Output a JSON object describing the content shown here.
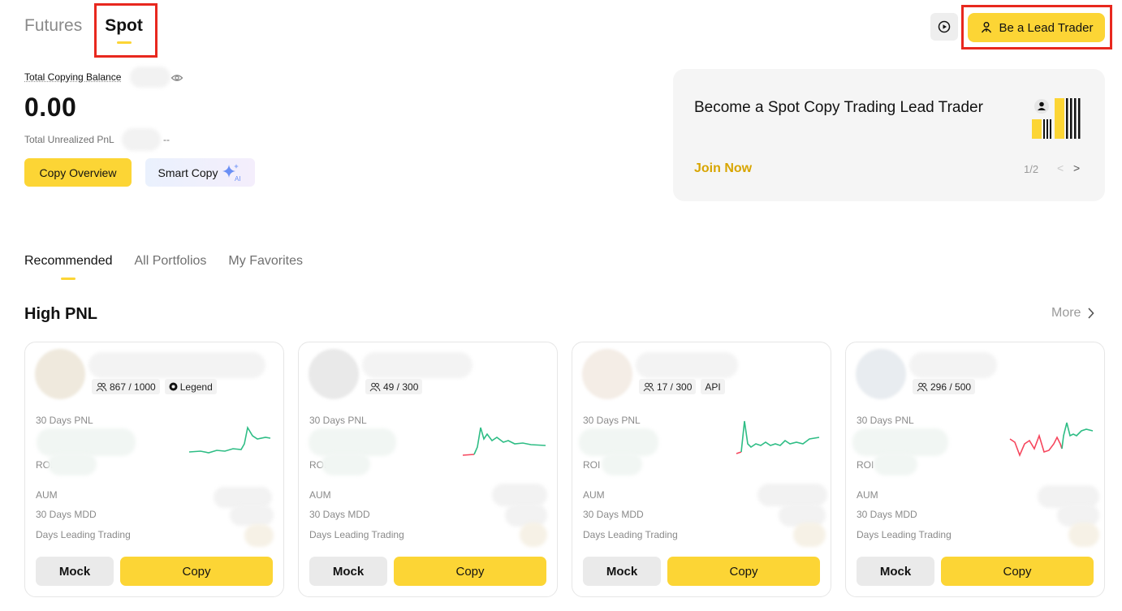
{
  "top_tabs": [
    {
      "label": "Futures",
      "active": false
    },
    {
      "label": "Spot",
      "active": true
    }
  ],
  "header": {
    "lead_trader_label": "Be a Lead Trader",
    "play_icon": "play-circle-icon",
    "lead_icon": "person-icon"
  },
  "balance": {
    "label": "Total Copying Balance",
    "value": "0.00",
    "pnl_label": "Total Unrealized PnL",
    "pnl_value": "--",
    "copy_overview_label": "Copy Overview",
    "smart_copy_label": "Smart Copy",
    "smart_copy_icon": "sparkle-ai-icon"
  },
  "promo": {
    "title": "Become a Spot Copy Trading Lead Trader",
    "cta": "Join Now",
    "page": "1/2",
    "prev": "<",
    "next": ">"
  },
  "sub_tabs": [
    {
      "label": "Recommended",
      "active": true
    },
    {
      "label": "All Portfolios",
      "active": false
    },
    {
      "label": "My Favorites",
      "active": false
    }
  ],
  "section": {
    "title": "High PNL",
    "more_label": "More"
  },
  "cards": [
    {
      "copiers": "867 / 1000",
      "tag": "Legend",
      "pnl_label": "30 Days PNL",
      "roi_label": "ROI",
      "aum_label": "AUM",
      "mdd_label": "30 Days MDD",
      "days_label": "Days Leading Trading",
      "mock_label": "Mock",
      "copy_label": "Copy"
    },
    {
      "copiers": "49 / 300",
      "tag": "",
      "pnl_label": "30 Days PNL",
      "roi_label": "ROI",
      "aum_label": "AUM",
      "mdd_label": "30 Days MDD",
      "days_label": "Days Leading Trading",
      "mock_label": "Mock",
      "copy_label": "Copy"
    },
    {
      "copiers": "17 / 300",
      "tag": "API",
      "pnl_label": "30 Days PNL",
      "roi_label": "ROI",
      "aum_label": "AUM",
      "mdd_label": "30 Days MDD",
      "days_label": "Days Leading Trading",
      "mock_label": "Mock",
      "copy_label": "Copy"
    },
    {
      "copiers": "296 / 500",
      "tag": "",
      "pnl_label": "30 Days PNL",
      "roi_label": "ROI",
      "aum_label": "AUM",
      "mdd_label": "30 Days MDD",
      "days_label": "Days Leading Trading",
      "mock_label": "Mock",
      "copy_label": "Copy"
    }
  ],
  "colors": {
    "accent": "#fcd535",
    "highlight_box": "#e8281e",
    "up": "#2ebd85",
    "down": "#f6465d"
  }
}
